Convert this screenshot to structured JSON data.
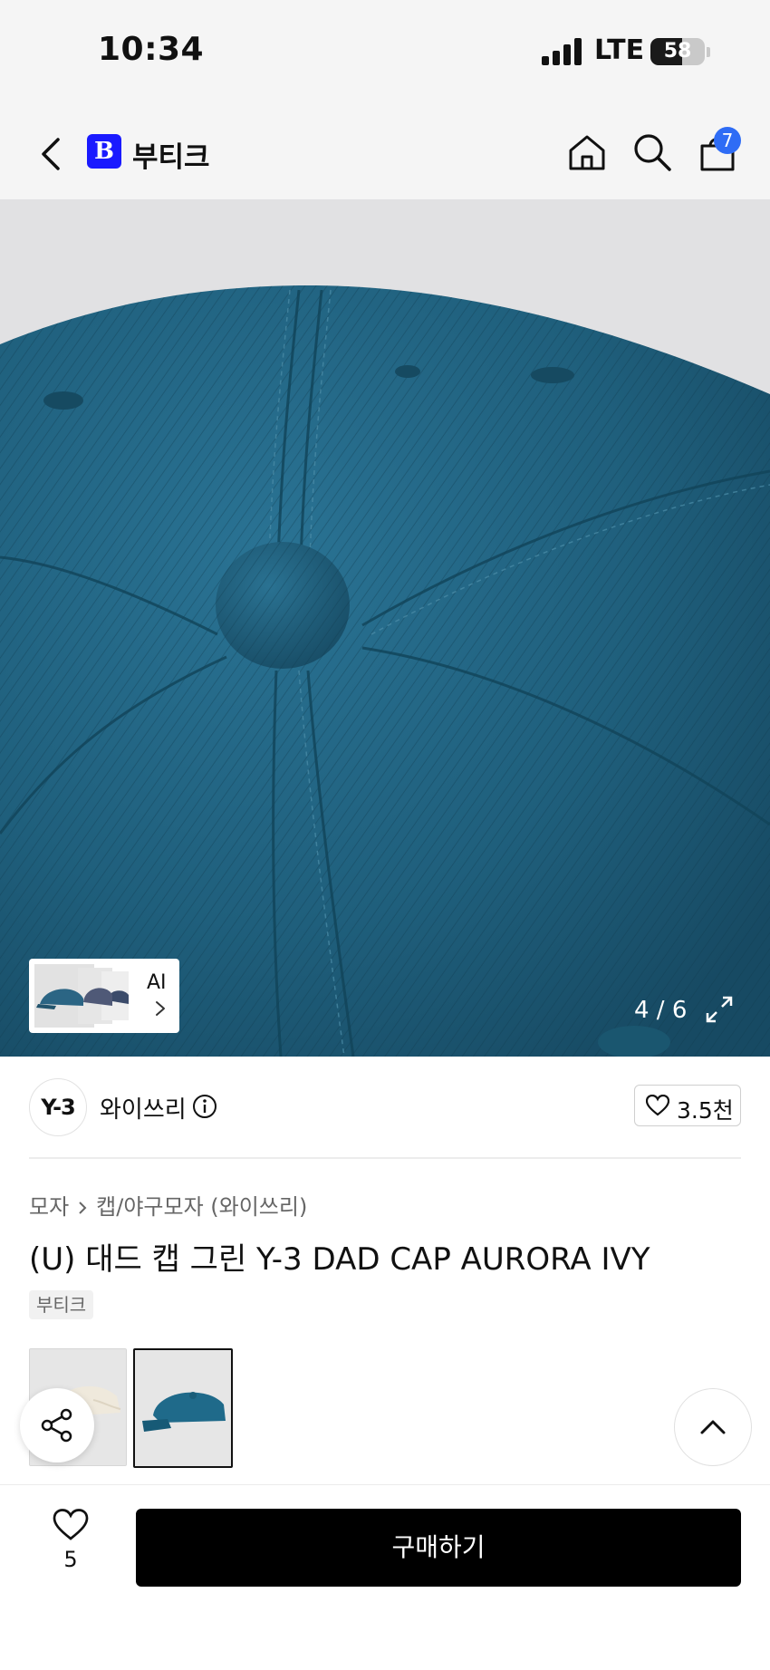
{
  "status_bar": {
    "time": "10:34",
    "network": "LTE",
    "battery": "58",
    "battery_level": 0.58
  },
  "nav": {
    "logo_letter": "B",
    "title": "부티크",
    "cart_count": "7",
    "icons": [
      "back-icon",
      "home-icon",
      "search-icon",
      "shopping-bag-icon"
    ]
  },
  "gallery": {
    "ai_label": "AI",
    "counter": "4 / 6",
    "icons": [
      "expand-icon",
      "chevron-right-icon"
    ]
  },
  "brand": {
    "logo_text": "Y-3",
    "name": "와이쓰리",
    "likes": "3.5천"
  },
  "product": {
    "breadcrumb": [
      "모자",
      "캡/야구모자 (와이쓰리)"
    ],
    "title": "(U) 대드 캡 그린 Y-3 DAD CAP AURORA IVY",
    "tag": "부티크"
  },
  "bottom": {
    "wish_count": "5",
    "buy_label": "구매하기"
  },
  "colors": {
    "accent_blue": "#2e6cf5",
    "logo_blue": "#1a1aff",
    "cap_teal": "#1f5f7c",
    "buy_button": "#000000"
  }
}
